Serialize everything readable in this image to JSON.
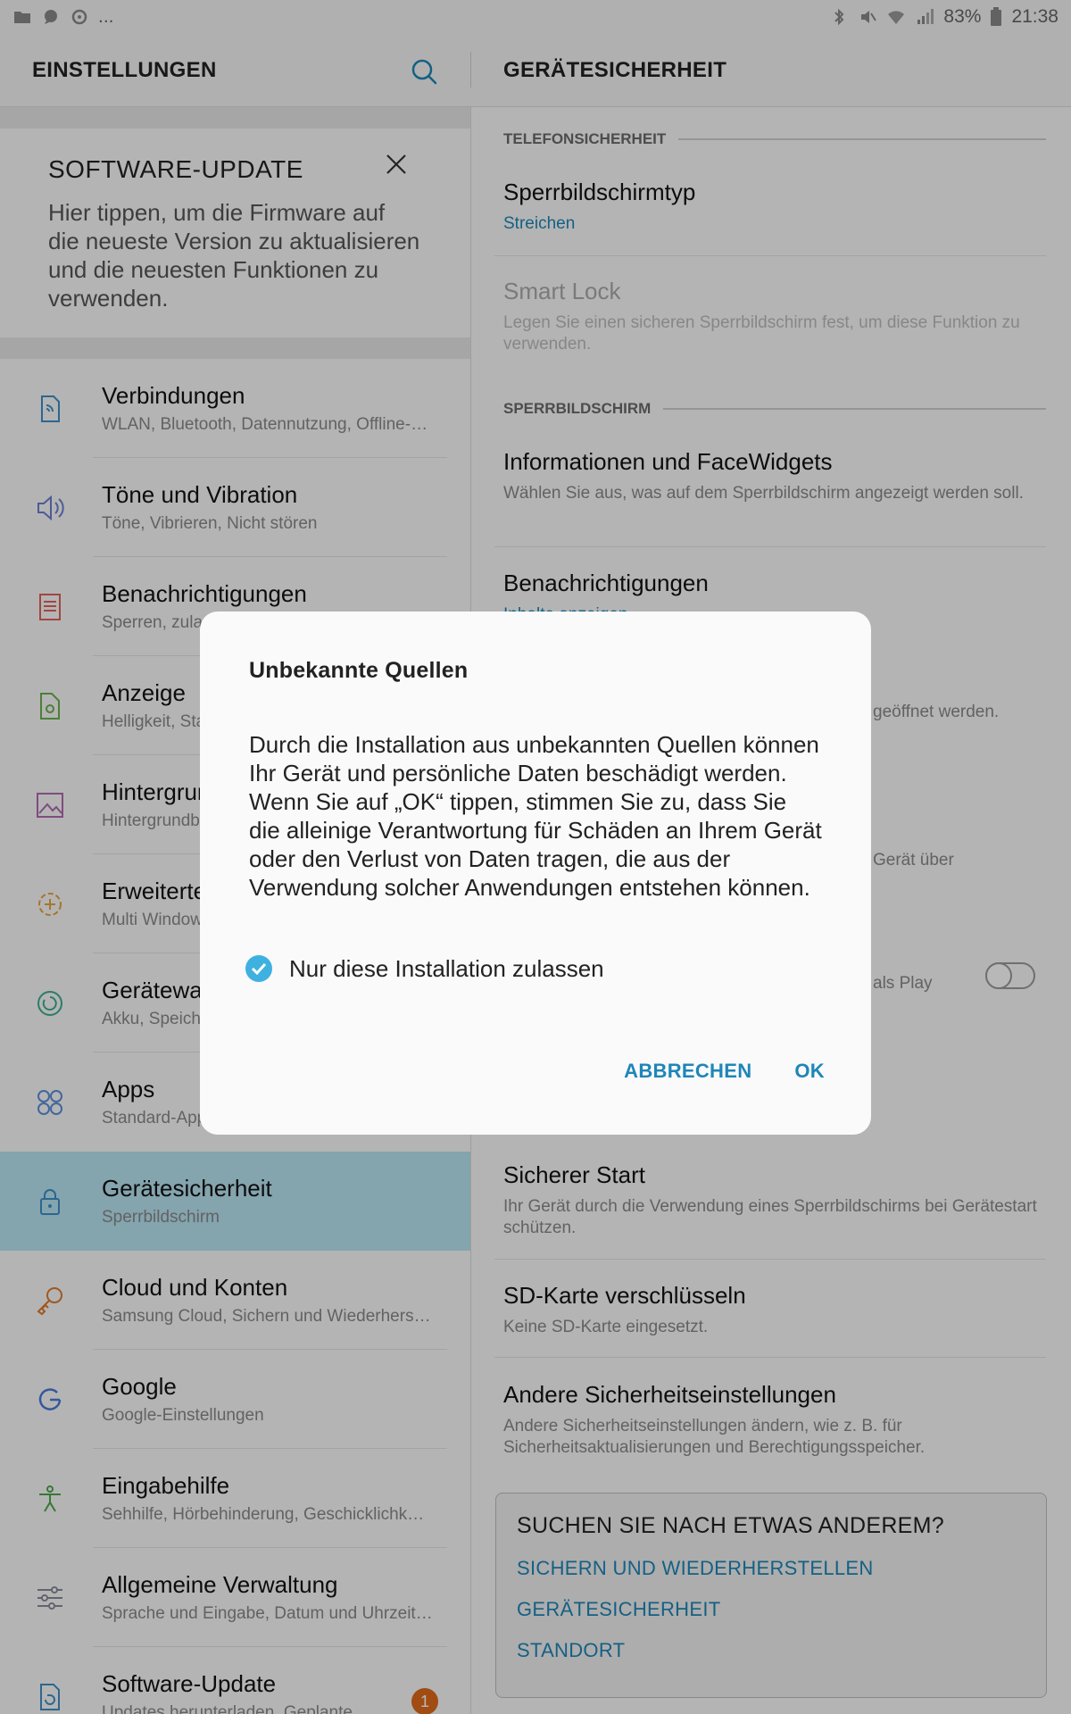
{
  "status_bar": {
    "battery": "83%",
    "time": "21:38",
    "ellipsis": "..."
  },
  "left_header": {
    "title": "EINSTELLUNGEN"
  },
  "right_header": {
    "title": "GERÄTESICHERHEIT"
  },
  "update_card": {
    "title": "SOFTWARE-UPDATE",
    "description": "Hier tippen, um die Firmware auf die neueste Version zu aktualisieren und die neuesten Funktionen zu verwenden."
  },
  "menu": [
    {
      "title": "Verbindungen",
      "subtitle": "WLAN, Bluetooth, Datennutzung, Offline-…",
      "icon": "connections-icon"
    },
    {
      "title": "Töne und Vibration",
      "subtitle": "Töne, Vibrieren, Nicht stören",
      "icon": "speaker-icon"
    },
    {
      "title": "Benachrichtigungen",
      "subtitle": "Sperren, zulassen",
      "icon": "notifications-icon"
    },
    {
      "title": "Anzeige",
      "subtitle": "Helligkeit, Statusleiste",
      "icon": "display-icon"
    },
    {
      "title": "Hintergrund",
      "subtitle": "Hintergrundbild",
      "icon": "wallpaper-icon"
    },
    {
      "title": "Erweiterte Funktionen",
      "subtitle": "Multi Window",
      "icon": "advanced-features-icon"
    },
    {
      "title": "Gerätewartung",
      "subtitle": "Akku, Speicher",
      "icon": "device-maintenance-icon"
    },
    {
      "title": "Apps",
      "subtitle": "Standard-Apps",
      "icon": "apps-icon"
    },
    {
      "title": "Gerätesicherheit",
      "subtitle": "Sperrbildschirm",
      "icon": "lock-icon"
    },
    {
      "title": "Cloud und Konten",
      "subtitle": "Samsung Cloud, Sichern und Wiederhers…",
      "icon": "key-icon"
    },
    {
      "title": "Google",
      "subtitle": "Google-Einstellungen",
      "icon": "google-icon"
    },
    {
      "title": "Eingabehilfe",
      "subtitle": "Sehhilfe, Hörbehinderung, Geschicklichk…",
      "icon": "accessibility-icon"
    },
    {
      "title": "Allgemeine Verwaltung",
      "subtitle": "Sprache und Eingabe, Datum und Uhrzeit…",
      "icon": "sliders-icon"
    },
    {
      "title": "Software-Update",
      "subtitle": "Updates herunterladen, Geplante…",
      "icon": "software-update-icon",
      "badge": "1"
    }
  ],
  "right": {
    "section_phone": "TELEFONSICHERHEIT",
    "lockscreen_type": {
      "title": "Sperrbildschirmtyp",
      "value": "Streichen"
    },
    "smart_lock": {
      "title": "Smart Lock",
      "subtitle": "Legen Sie einen sicheren Sperrbildschirm fest, um diese Funktion zu verwenden."
    },
    "section_lockscreen": "SPERRBILDSCHIRM",
    "info_facewidgets": {
      "title": "Informationen und FaceWidgets",
      "subtitle": "Wählen Sie aus, was auf dem Sperrbildschirm angezeigt werden soll."
    },
    "notifications": {
      "title": "Benachrichtigungen",
      "value": "Inhalte anzeigen"
    },
    "partial1": "geöffnet werden.",
    "partial2": "Gerät über",
    "partial3": "als Play",
    "secure_start": {
      "title": "Sicherer Start",
      "subtitle": "Ihr Gerät durch die Verwendung eines Sperrbildschirms bei Gerätestart schützen."
    },
    "sd_encrypt": {
      "title": "SD-Karte verschlüsseln",
      "subtitle": "Keine SD-Karte eingesetzt."
    },
    "other_security": {
      "title": "Andere Sicherheitseinstellungen",
      "subtitle": "Andere Sicherheitseinstellungen ändern, wie z. B. für Sicherheitsaktualisierungen und Berechtigungsspeicher."
    }
  },
  "suggest": {
    "title": "SUCHEN SIE NACH ETWAS ANDEREM?",
    "links": [
      "SICHERN UND WIEDERHERSTELLEN",
      "GERÄTESICHERHEIT",
      "STANDORT"
    ]
  },
  "dialog": {
    "title": "Unbekannte Quellen",
    "message": "Durch die Installation aus unbekannten Quellen können Ihr Gerät und persönliche Daten beschädigt werden. Wenn Sie auf „OK“ tippen, stimmen Sie zu, dass Sie die alleinige Verantwortung für Schäden an Ihrem Gerät oder den Verlust von Daten tragen, die aus der Verwendung solcher Anwendungen entstehen können.",
    "checkbox_label": "Nur diese Installation zulassen",
    "checkbox_checked": true,
    "cancel_label": "ABBRECHEN",
    "ok_label": "OK"
  },
  "colors": {
    "accent": "#1e86b8",
    "active_bg": "#b7e3f2",
    "badge": "#e06a1b",
    "checkbox": "#3fb1e0"
  }
}
